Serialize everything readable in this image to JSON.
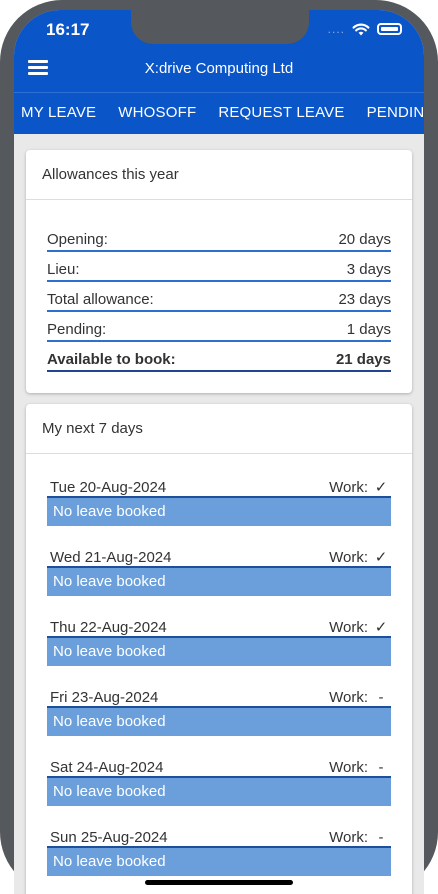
{
  "status": {
    "time": "16:17",
    "signal": "....",
    "wifi_icon": "wifi-icon",
    "battery_icon": "battery-icon"
  },
  "header": {
    "title": "X:drive Computing Ltd",
    "menu_icon": "hamburger-menu-icon"
  },
  "tabs": [
    {
      "label": "MY LEAVE"
    },
    {
      "label": "WHOSOFF"
    },
    {
      "label": "REQUEST LEAVE"
    },
    {
      "label": "PENDING L"
    }
  ],
  "allowances": {
    "title": "Allowances this year",
    "rows": [
      {
        "label": "Opening:",
        "value": "20 days"
      },
      {
        "label": "Lieu:",
        "value": "3 days"
      },
      {
        "label": "Total allowance:",
        "value": "23 days"
      },
      {
        "label": "Pending:",
        "value": "1 days"
      },
      {
        "label": "Available to book:",
        "value": "21 days"
      }
    ]
  },
  "next7": {
    "title": "My next 7 days",
    "days": [
      {
        "date": "Tue 20-Aug-2024",
        "work_label": "Work:",
        "work_value": "✓",
        "status": "No leave booked"
      },
      {
        "date": "Wed 21-Aug-2024",
        "work_label": "Work:",
        "work_value": "✓",
        "status": "No leave booked"
      },
      {
        "date": "Thu 22-Aug-2024",
        "work_label": "Work:",
        "work_value": "✓",
        "status": "No leave booked"
      },
      {
        "date": "Fri 23-Aug-2024",
        "work_label": "Work:",
        "work_value": "-",
        "status": "No leave booked"
      },
      {
        "date": "Sat 24-Aug-2024",
        "work_label": "Work:",
        "work_value": "-",
        "status": "No leave booked"
      },
      {
        "date": "Sun 25-Aug-2024",
        "work_label": "Work:",
        "work_value": "-",
        "status": "No leave booked"
      }
    ]
  },
  "colors": {
    "primary": "#0a55c8",
    "bar": "#6a9fdc",
    "background": "#e9e9e9"
  }
}
